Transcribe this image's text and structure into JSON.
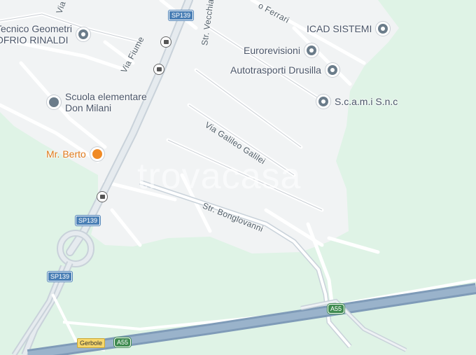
{
  "pois": [
    {
      "name": "poi-geometri",
      "text1": "Tecnico Geometri",
      "text2": "OFRIO RINALDI"
    },
    {
      "name": "poi-icad",
      "text1": "ICAD SISTEMI"
    },
    {
      "name": "poi-eurorevisioni",
      "text1": "Eurorevisioni"
    },
    {
      "name": "poi-drusilla",
      "text1": "Autotrasporti Drusilla"
    },
    {
      "name": "poi-scami",
      "text1": "S.c.a.m.i S.n.c"
    },
    {
      "name": "poi-school",
      "text1": "Scuola elementare",
      "text2": "Don Milani"
    },
    {
      "name": "poi-berto",
      "text1": "Mr. Berto"
    }
  ],
  "streets": {
    "via_fiume": "Via Fiume",
    "via_galileo": "Via Galileo Galilei",
    "str_bonglovanni": "Str. Bonglovanni",
    "str_vecchia": "Str. Vecchia",
    "via_top": "Via",
    "via_ferrari": "o Ferrari"
  },
  "shields": {
    "sp139": "SP139",
    "a55": "A55",
    "gerbole": "Gerbole"
  },
  "watermark": "trovacasa"
}
